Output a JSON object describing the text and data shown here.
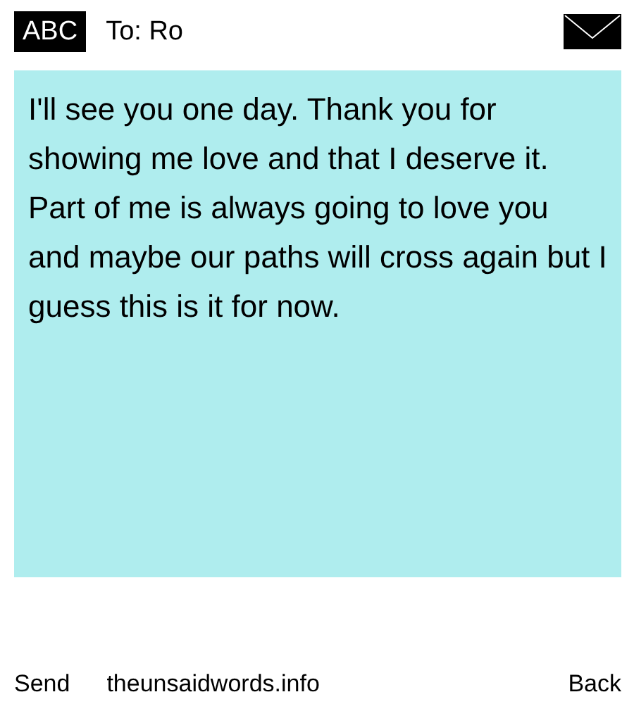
{
  "header": {
    "input_mode": "ABC",
    "recipient": "To: Ro"
  },
  "message": {
    "text": "I'll see you one day. Thank you for showing me love and that I deserve it. Part of me is always going to love you and maybe our paths will cross again but I guess this is it for now."
  },
  "softkeys": [
    {
      "kind": "left",
      "label": "Send"
    },
    {
      "kind": "center",
      "label": "theunsaidwords.info"
    },
    {
      "kind": "right",
      "label": "Back"
    }
  ]
}
